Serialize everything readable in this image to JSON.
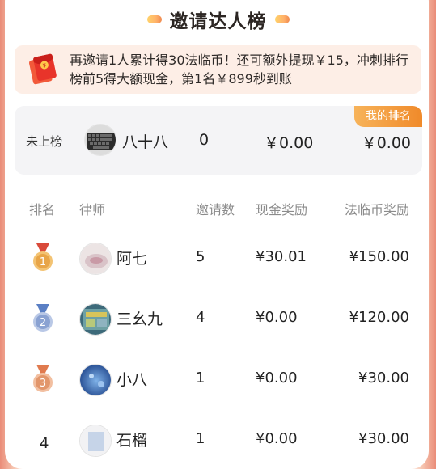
{
  "title": "邀请达人榜",
  "notice": {
    "text": "再邀请1人累计得30法临币！还可额外提现￥15，冲刺排行榜前5得大额现金，第1名￥899秒到账",
    "icon": "red-envelope-icon"
  },
  "my_rank": {
    "badge": "我的排名",
    "rank": "未上榜",
    "name": "八十八",
    "invites": "0",
    "cash": "￥0.00",
    "coins": "￥0.00"
  },
  "table": {
    "headers": [
      "排名",
      "律师",
      "邀请数",
      "现金奖励",
      "法临币奖励"
    ],
    "rows": [
      {
        "rank": "1",
        "name": "阿七",
        "invites": "5",
        "cash": "¥30.01",
        "coins": "¥150.00"
      },
      {
        "rank": "2",
        "name": "三幺九",
        "invites": "4",
        "cash": "¥0.00",
        "coins": "¥120.00"
      },
      {
        "rank": "3",
        "name": "小八",
        "invites": "1",
        "cash": "¥0.00",
        "coins": "¥30.00"
      },
      {
        "rank": "4",
        "name": "石榴",
        "invites": "1",
        "cash": "¥0.00",
        "coins": "¥30.00"
      }
    ]
  },
  "colors": {
    "accent_orange": "#f08a2a",
    "gold": "#e2a64a",
    "silver": "#7f9bc8",
    "bronze": "#e0946a"
  }
}
